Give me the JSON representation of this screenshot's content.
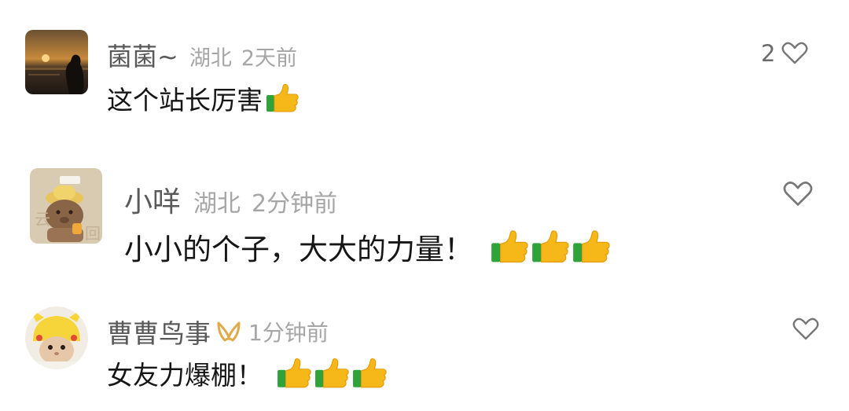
{
  "comments": [
    {
      "user": "菌菌~",
      "location": "湖北",
      "time": "2天前",
      "text": "这个站长厉害",
      "like_count": "2",
      "avatar_icon": "sunset-silhouette-avatar",
      "thumbs": 1
    },
    {
      "user": "小咩",
      "location": "湖北",
      "time": "2分钟前",
      "text": "小小的个子，大大的力量！",
      "like_count": "",
      "avatar_icon": "capybara-sticker-avatar",
      "thumbs": 3
    },
    {
      "user": "曹曹鸟事",
      "location": "",
      "time": "1分钟前",
      "text": "女友力爆棚！",
      "like_count": "",
      "avatar_icon": "pikachu-hat-cat-avatar",
      "badge_icon": "gold-ribbon-badge-icon",
      "thumbs": 3
    }
  ],
  "colors": {
    "thumb_hand": "#f6b818",
    "thumb_cuff": "#2fa23a",
    "badge": "#e0a94a",
    "heart_stroke": "#777777"
  }
}
